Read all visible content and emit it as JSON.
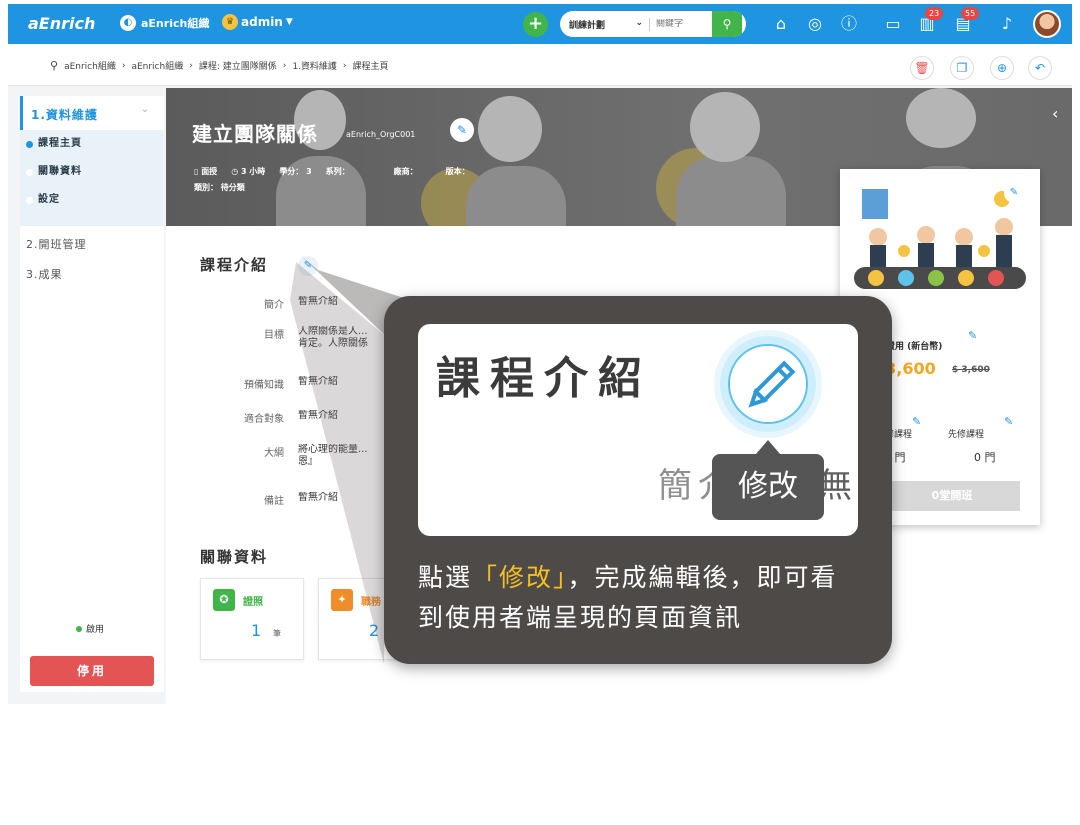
{
  "topbar": {
    "logo": "aEnrich",
    "org": "aEnrich組織",
    "admin": "admin",
    "plus": "+",
    "search_type": "訓練計劃",
    "search_placeholder": "關鍵字",
    "badge_left": "23",
    "badge_right": "55"
  },
  "breadcrumb": [
    "aEnrich組織",
    "aEnrich組織",
    "課程: 建立團隊關係",
    "1.資料維護",
    "課程主頁"
  ],
  "sidebar": {
    "section1_title": "1.資料維護",
    "sub_items": [
      "課程主頁",
      "關聯資料",
      "設定"
    ],
    "section2": "2.開班管理",
    "section3": "3.成果",
    "status": "啟用",
    "stop_button": "停用"
  },
  "banner": {
    "title": "建立團隊關係",
    "code": "aEnrich_OrgC001",
    "meta": [
      "面授",
      "3 小時",
      "學分： 3",
      "系列：",
      "廠商：",
      "版本："
    ],
    "category": "類別： 待分類"
  },
  "intro": {
    "title": "課程介紹",
    "fields": [
      {
        "label": "簡介",
        "value": "暫無介紹"
      },
      {
        "label": "目標",
        "value": "人際關係是人..."
      },
      {
        "label": "預備知識",
        "value": "暫無介紹"
      },
      {
        "label": "適合對象",
        "value": "暫無介紹"
      },
      {
        "label": "大綱",
        "value": "將心理的能量..."
      },
      {
        "label": "備註",
        "value": "暫無介紹"
      }
    ],
    "goal_line2": "肯定。人際關係",
    "outline_line2": "恩』"
  },
  "related": {
    "title": "關聯資料",
    "cards": [
      {
        "name": "證照",
        "count": "1",
        "unit": "筆"
      },
      {
        "name": "職務",
        "count": "2",
        "unit": ""
      }
    ]
  },
  "price_card": {
    "fee_label": "費用 (新台幣)",
    "price": "$3,600",
    "old_price": "$ 3,600",
    "sub1_label": "預修課程",
    "sub2_label": "先修課程",
    "sub1_value": "0 門",
    "sub2_value": "0 門",
    "open_button": "0堂開班"
  },
  "callout": {
    "zoom_title": "課程介紹",
    "zoom_bg1": "簡介",
    "zoom_bg2": "暫無",
    "tooltip": "修改",
    "caption_pre": "點選",
    "caption_hl": "「修改」",
    "caption_post": "，完成編輯後，即可看到使用者端呈現的頁面資訊"
  },
  "colors": {
    "primary": "#1f94e0",
    "green": "#41b54a",
    "danger": "#e35454",
    "price": "#f5a623",
    "highlight": "#f6c021",
    "callout_bg": "#4e4a48"
  },
  "icons": [
    "globe-icon",
    "crown-icon",
    "search-icon",
    "home-icon",
    "compass-icon",
    "help-icon",
    "chat-icon",
    "chart-icon",
    "doc-icon",
    "bell-icon",
    "pin-icon",
    "trash-icon",
    "copy-icon",
    "duplicate-icon",
    "undo-icon",
    "pencil-icon",
    "book-icon",
    "clock-icon",
    "certificate-icon",
    "job-icon",
    "menu-icon"
  ]
}
